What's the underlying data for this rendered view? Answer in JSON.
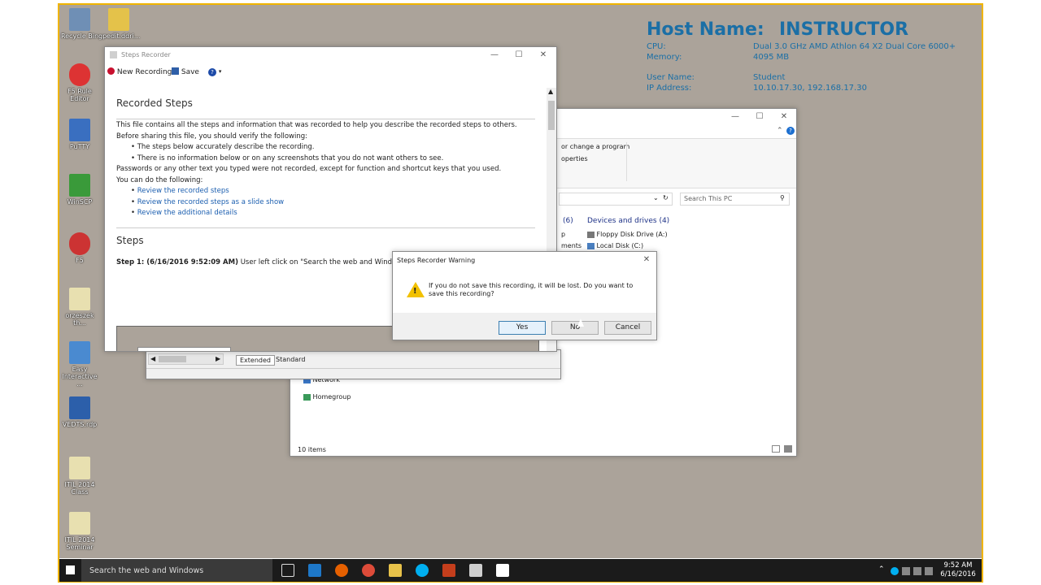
{
  "desktop_icons": [
    {
      "label": "Recycle Bin",
      "color": "#6f8fb5"
    },
    {
      "label": "gpedit.ddri...",
      "color": "#e4c24a"
    },
    {
      "label": "F5 Rule Editor",
      "color": "#d33"
    },
    {
      "label": "PuTTY",
      "color": "#3a6fc0"
    },
    {
      "label": "WinSCP",
      "color": "#3a9a3a"
    },
    {
      "label": "F5",
      "color": "#c33"
    },
    {
      "label": "orzeszek th...",
      "color": "#e8e0b0"
    },
    {
      "label": "Easy Interactive ...",
      "color": "#4a8ad0"
    },
    {
      "label": "VEDTS.rdp",
      "color": "#2c5faa"
    },
    {
      "label": "ITIL 2014 Class",
      "color": "#e8e0b0"
    },
    {
      "label": "ITIL 2014 Seminar",
      "color": "#e8e0b0"
    }
  ],
  "sysinfo": {
    "host_label": "Host Name:",
    "host_value": "INSTRUCTOR",
    "cpu_label": "CPU:",
    "cpu_value": "Dual 3.0 GHz AMD Athlon 64 X2 Dual Core 6000+",
    "memory_label": "Memory:",
    "memory_value": "4095 MB",
    "user_label": "User Name:",
    "user_value": "Student",
    "ip_label": "IP Address:",
    "ip_value": "10.10.17.30, 192.168.17.30"
  },
  "steps_recorder": {
    "title": "Steps Recorder",
    "toolbar": {
      "new_recording": "New Recording",
      "save": "Save"
    },
    "heading": "Recorded Steps",
    "intro": "This file contains all the steps and information that was recorded to help you describe the recorded steps to others.",
    "verify_intro": "Before sharing this file, you should verify the following:",
    "bullets": [
      "The steps below accurately describe the recording.",
      "There is no information below or on any screenshots that you do not want others to see."
    ],
    "passwords_note": "Passwords or any other text you typed were not recorded, except for function and shortcut keys that you used.",
    "can_do": "You can do the following:",
    "links": [
      "Review the recorded steps",
      "Review the recorded steps as a slide show",
      "Review the additional details"
    ],
    "steps_heading": "Steps",
    "step1_prefix": "Step 1: (6/16/2016 9:52:09 AM)",
    "step1_text": "User left click on \"Search the web and Windows"
  },
  "explorer": {
    "ribbon_items": [
      "or change a program",
      "operties"
    ],
    "search_placeholder": "Search This PC",
    "folders_count": "(6)",
    "devices_heading": "Devices and drives (4)",
    "left_fragments": [
      "p",
      "ments"
    ],
    "drives": [
      "Floppy Disk Drive (A:)",
      "Local Disk (C:)"
    ],
    "nav_items": [
      "Network",
      "Homegroup"
    ],
    "status": "10 items"
  },
  "calc_tabs": [
    "Extended",
    "Standard"
  ],
  "dialog": {
    "title": "Steps Recorder Warning",
    "message": "If you do not save this recording, it will be lost. Do you want to save this recording?",
    "yes": "Yes",
    "no": "No",
    "cancel": "Cancel"
  },
  "taskbar": {
    "search": "Search the web and Windows",
    "time": "9:52 AM",
    "date": "6/16/2016"
  }
}
